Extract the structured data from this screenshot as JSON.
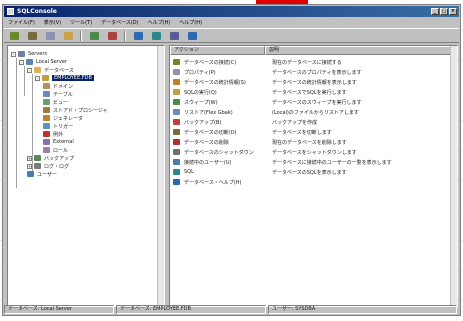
{
  "window": {
    "title": "SQLConsole"
  },
  "menu": [
    "ファイル(F)",
    "表示(V)",
    "ツール(T)",
    "データベース(D)",
    "ヘルプ(H)",
    "ヘルプ(H)"
  ],
  "toolbar_buttons": [
    {
      "icon": "connect-icon",
      "color": "#6a8a2a"
    },
    {
      "icon": "disconnect-icon",
      "color": "#7a6a3a"
    },
    {
      "icon": "properties-icon",
      "color": "#9090b0"
    },
    {
      "icon": "folder-icon",
      "color": "#c9a24a"
    },
    {
      "icon": "refresh-icon",
      "color": "#4a8a4a"
    },
    {
      "icon": "stop-icon",
      "color": "#b04040"
    },
    {
      "icon": "check-icon",
      "color": "#2a6ab0"
    },
    {
      "icon": "run-icon",
      "color": "#2a8a8a"
    },
    {
      "icon": "filter-icon",
      "color": "#5a5a9a"
    },
    {
      "icon": "help-icon",
      "color": "#2a6ab0"
    }
  ],
  "tree": [
    {
      "label": "Servers",
      "indent": 0,
      "icon": "servers-icon",
      "color": "#7080a0",
      "expander": "-"
    },
    {
      "label": "Local Server",
      "indent": 1,
      "icon": "server-icon",
      "color": "#6080b0",
      "expander": "-"
    },
    {
      "label": "データベース",
      "indent": 2,
      "icon": "folder-icon",
      "color": "#d9b25a",
      "expander": "-"
    },
    {
      "label": "EMPLOYEE.FDB",
      "indent": 3,
      "icon": "database-icon",
      "color": "#c0a040",
      "expander": "-",
      "selected": true
    },
    {
      "label": "ドメイン",
      "indent": 4,
      "icon": "domain-icon",
      "color": "#b09060"
    },
    {
      "label": "テーブル",
      "indent": 4,
      "icon": "table-icon",
      "color": "#6a8ac0"
    },
    {
      "label": "ビュー",
      "indent": 4,
      "icon": "view-icon",
      "color": "#6aa06a"
    },
    {
      "label": "ストアド・プロシージャ",
      "indent": 4,
      "icon": "procedure-icon",
      "color": "#a07a3a"
    },
    {
      "label": "ジェネレータ",
      "indent": 4,
      "icon": "generator-icon",
      "color": "#c08030"
    },
    {
      "label": "トリガー",
      "indent": 4,
      "icon": "trigger-icon",
      "color": "#6090c0"
    },
    {
      "label": "例外",
      "indent": 4,
      "icon": "exception-icon",
      "color": "#c03030"
    },
    {
      "label": "External",
      "indent": 4,
      "icon": "external-icon",
      "color": "#8a70b0"
    },
    {
      "label": "ロール",
      "indent": 4,
      "icon": "role-icon",
      "color": "#a080a0"
    },
    {
      "label": "バックアップ",
      "indent": 2,
      "icon": "backup-icon",
      "color": "#5a8a5a",
      "expander": "+"
    },
    {
      "label": "ログ・ログ",
      "indent": 2,
      "icon": "log-icon",
      "color": "#7a7a7a",
      "expander": "+"
    },
    {
      "label": "ユーザー",
      "indent": 2,
      "icon": "users-icon",
      "color": "#4a7ab0"
    }
  ],
  "list": {
    "columns": [
      "アクション",
      "説明"
    ],
    "rows": [
      {
        "name": "データベースの接続(C)",
        "desc": "現在のデータベースに接続する",
        "icon": "connect-icon",
        "color": "#6a8a2a"
      },
      {
        "name": "プロパティ(P)",
        "desc": "データベースのプロパティを表示します",
        "icon": "properties-icon",
        "color": "#9090b0"
      },
      {
        "name": "データベースの統計情報(S)",
        "desc": "データベースの統計情報を表示します",
        "icon": "statistics-icon",
        "color": "#c08030"
      },
      {
        "name": "SQLの実行(Q)",
        "desc": "データベースでSQLを実行します",
        "icon": "sql-icon",
        "color": "#c0a040"
      },
      {
        "name": "スウィープ(W)",
        "desc": "データベースのスウィープを実行します",
        "icon": "sweep-icon",
        "color": "#4a8a4a"
      },
      {
        "name": "リストア(Flex Gbak)",
        "desc": "(Local)のファイルからリストアします",
        "icon": "restore-icon",
        "color": "#6a8ac0"
      },
      {
        "name": "バックアップ(B)",
        "desc": "バックアップを作成",
        "icon": "backup-icon",
        "color": "#c04040"
      },
      {
        "name": "データベースの切断(D)",
        "desc": "データベースを切断します",
        "icon": "disconnect-icon",
        "color": "#7a6a3a"
      },
      {
        "name": "データベースの削除",
        "desc": "現在のデータベースを削除します",
        "icon": "delete-icon",
        "color": "#b03030"
      },
      {
        "name": "データベースのシャットダウン",
        "desc": "データベースをシャットダウンします",
        "icon": "shutdown-icon",
        "color": "#707070"
      },
      {
        "name": "接続中のユーザー(U)",
        "desc": "データベースに接続中のユーザーの一覧を表示します",
        "icon": "users-icon",
        "color": "#4a7ab0"
      },
      {
        "name": "SQL",
        "desc": "データベースのSQLを表示します",
        "icon": "sql-icon",
        "color": "#2a8a8a"
      },
      {
        "name": "データベース・ヘルプ(H)",
        "desc": "",
        "icon": "help-icon",
        "color": "#2a6ab0"
      }
    ]
  },
  "status": [
    "データベース: Local Server",
    "データベース: EMPLOYEE.FDB",
    "ユーザー: SYSDBA"
  ],
  "colors": {
    "accent": "#e00000",
    "selection": "#0a246a",
    "titlebar": "#0a246a"
  }
}
